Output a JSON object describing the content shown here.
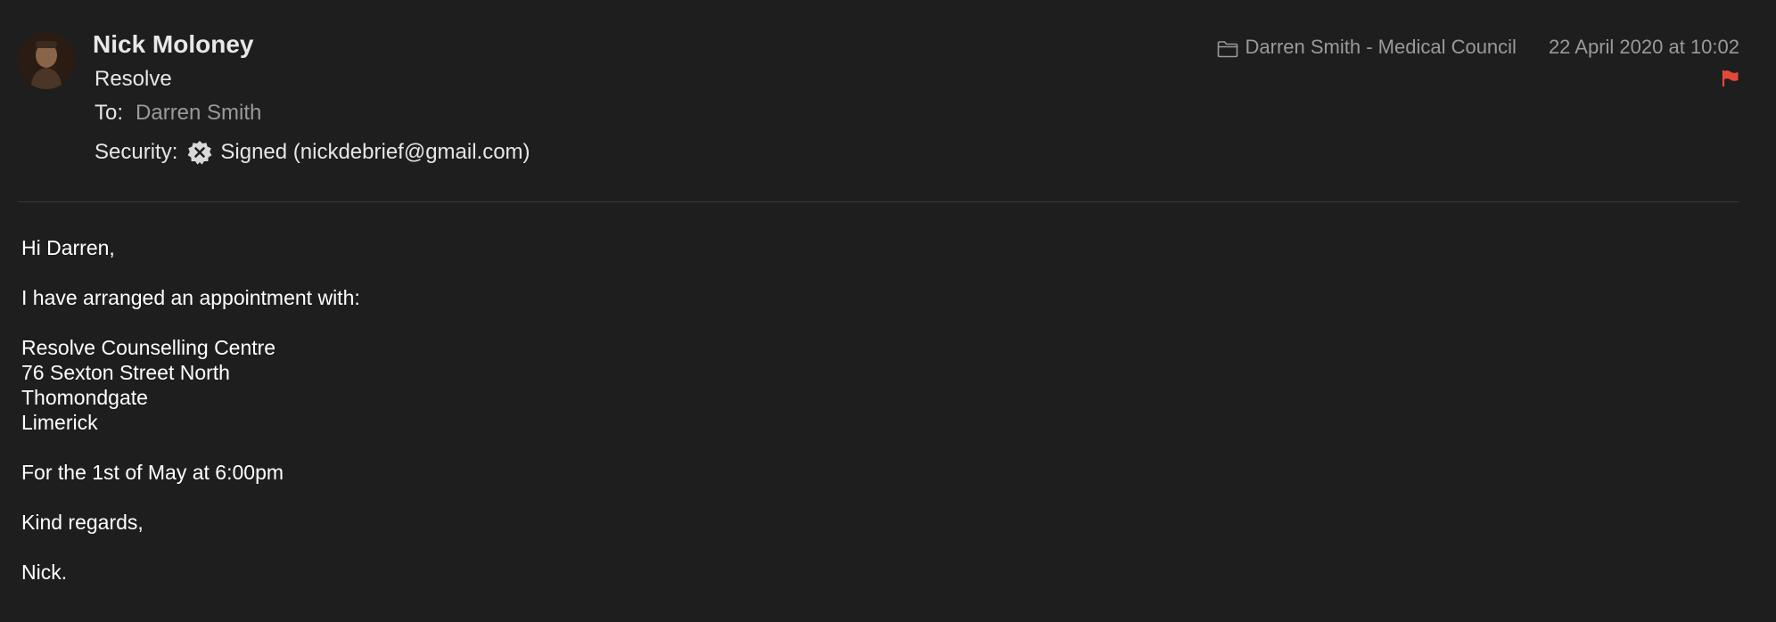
{
  "header": {
    "sender_name": "Nick Moloney",
    "subject": "Resolve",
    "to_label": "To:",
    "to_value": "Darren Smith",
    "security_label": "Security:",
    "security_value": "Signed (nickdebrief@gmail.com)",
    "mailbox": "Darren Smith - Medical Council",
    "date": "22 April 2020 at 10:02",
    "flag_color": "#e5483b"
  },
  "body": {
    "greeting": "Hi Darren,",
    "intro": "I have arranged an appointment with:",
    "address": [
      "Resolve Counselling Centre",
      "76 Sexton Street North",
      "Thomondgate",
      "Limerick"
    ],
    "appointment": "For the 1st of May at 6:00pm",
    "closing": "Kind regards,",
    "signature": "Nick."
  },
  "icons": {
    "avatar": "avatar-photo",
    "security": "signed-badge-icon",
    "mailbox": "folder-icon",
    "flag": "flag-icon"
  }
}
